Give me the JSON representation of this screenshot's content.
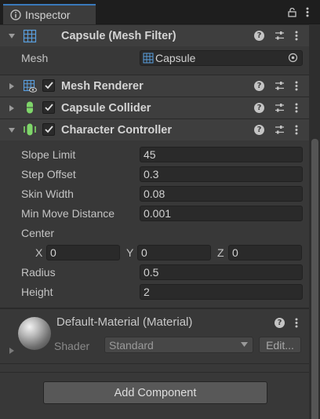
{
  "window": {
    "tab_label": "Inspector",
    "tab_icon": "info-icon",
    "tool_icons": [
      "lock-icon",
      "kebab-menu-icon"
    ]
  },
  "components": [
    {
      "title": "Capsule (Mesh Filter)",
      "icon": "mesh-filter-icon",
      "expanded": true,
      "has_checkbox": false
    },
    {
      "title": "Mesh Renderer",
      "icon": "mesh-renderer-icon",
      "expanded": false,
      "checked": true
    },
    {
      "title": "Capsule Collider",
      "icon": "capsule-collider-icon",
      "expanded": false,
      "checked": true
    },
    {
      "title": "Character Controller",
      "icon": "character-controller-icon",
      "expanded": true,
      "checked": true
    }
  ],
  "mesh_filter": {
    "mesh_label": "Mesh",
    "mesh_value": "Capsule"
  },
  "character_controller": {
    "slope_limit": {
      "label": "Slope Limit",
      "value": "45"
    },
    "step_offset": {
      "label": "Step Offset",
      "value": "0.3"
    },
    "skin_width": {
      "label": "Skin Width",
      "value": "0.08"
    },
    "min_move_distance": {
      "label": "Min Move Distance",
      "value": "0.001"
    },
    "center": {
      "label": "Center",
      "x_label": "X",
      "x": "0",
      "y_label": "Y",
      "y": "0",
      "z_label": "Z",
      "z": "0"
    },
    "radius": {
      "label": "Radius",
      "value": "0.5"
    },
    "height": {
      "label": "Height",
      "value": "2"
    }
  },
  "material": {
    "title": "Default-Material (Material)",
    "shader_label": "Shader",
    "shader_value": "Standard",
    "edit_label": "Edit..."
  },
  "add_component_label": "Add Component",
  "colors": {
    "accent": "#3a79bb",
    "panel": "#383838",
    "header": "#3e3e3e",
    "field": "#2a2a2a",
    "icon_green": "#7fd66a"
  }
}
